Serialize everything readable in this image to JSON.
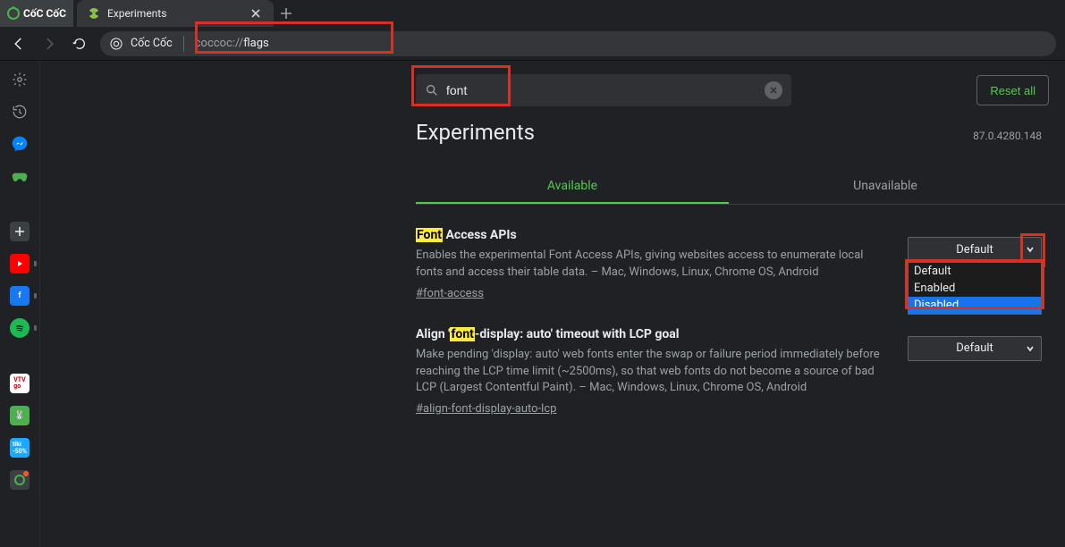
{
  "app_name": "CốC CốC",
  "tab": {
    "title": "Experiments"
  },
  "address": {
    "site_label": "Cốc Cốc",
    "scheme": "coccoc://",
    "path": "flags"
  },
  "search": {
    "value": "font"
  },
  "reset_label": "Reset all",
  "page_title": "Experiments",
  "version": "87.0.4280.148",
  "tabs": {
    "available": "Available",
    "unavailable": "Unavailable"
  },
  "dropdown_options": [
    "Default",
    "Enabled",
    "Disabled"
  ],
  "experiments": [
    {
      "title_pre_hl": "",
      "title_hl": "Font",
      "title_post_hl": " Access APIs",
      "desc": "Enables the experimental Font Access APIs, giving websites access to enumerate local fonts and access their table data. – Mac, Windows, Linux, Chrome OS, Android",
      "anchor": "#font-access",
      "selected": "Default",
      "open": true
    },
    {
      "title_pre_hl": "Align '",
      "title_hl": "font",
      "title_post_hl": "-display: auto' timeout with LCP goal",
      "desc": "Make pending 'display: auto' web fonts enter the swap or failure period immediately before reaching the LCP time limit (~2500ms), so that web fonts do not become a source of bad LCP (Largest Contentful Paint). – Mac, Windows, Linux, Chrome OS, Android",
      "anchor": "#align-font-display-auto-lcp",
      "selected": "Default",
      "open": false
    }
  ]
}
